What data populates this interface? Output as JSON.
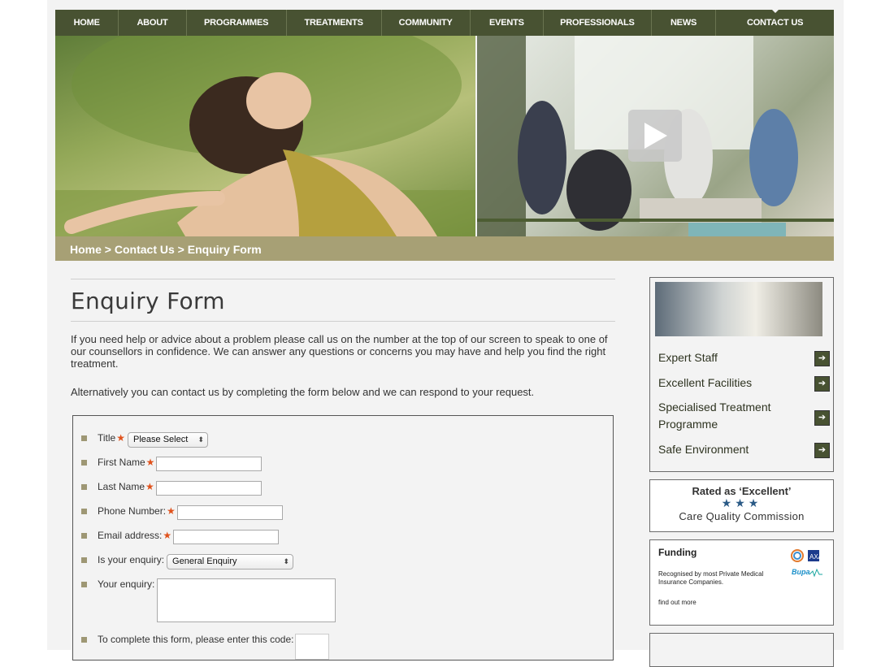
{
  "nav": {
    "items": [
      {
        "label": "HOME",
        "width": 78
      },
      {
        "label": "ABOUT",
        "width": 83
      },
      {
        "label": "PROGRAMMES",
        "width": 123
      },
      {
        "label": "TREATMENTS",
        "width": 117
      },
      {
        "label": "COMMUNITY",
        "width": 109
      },
      {
        "label": "EVENTS",
        "width": 90
      },
      {
        "label": "PROFESSIONALS",
        "width": 133
      },
      {
        "label": "NEWS",
        "width": 79
      },
      {
        "label": "CONTACT US",
        "width": 146
      }
    ]
  },
  "breadcrumb": {
    "home": "Home",
    "sep1": ">",
    "contact": "Contact Us",
    "sep2": ">",
    "current": "Enquiry Form"
  },
  "main": {
    "title": "Enquiry Form",
    "intro1": "If you need help or advice about a problem please call us on the number at the top of our screen to speak to one of our counsellors in confidence. We can answer any questions or concerns you may have and help you find the right treatment.",
    "intro2": "Alternatively you can contact us by completing the form below and we can respond to your request."
  },
  "form": {
    "title_label": "Title",
    "title_value": "Please Select",
    "first_name_label": "First Name",
    "last_name_label": "Last Name",
    "phone_label": "Phone Number:",
    "email_label": "Email address:",
    "enquiry_type_label": "Is your enquiry:",
    "enquiry_type_value": "General Enquiry",
    "enquiry_label": "Your enquiry:",
    "captcha_label": "To complete this form, please enter this code:",
    "required_mark": "★"
  },
  "sidebar": {
    "links": [
      {
        "label": "Expert Staff"
      },
      {
        "label": "Excellent Facilities"
      },
      {
        "label": "Specialised Treatment Programme"
      },
      {
        "label": "Safe Environment"
      }
    ],
    "arrow": "➔",
    "rating": {
      "rated": "Rated as ‘Excellent’",
      "stars": "★★★",
      "org": "Care Quality Commission"
    },
    "funding": {
      "title": "Funding",
      "desc": "Recognised by most Private Medical Insurance Companies.",
      "more": "find out more",
      "bupa": "Bupa"
    }
  },
  "colors": {
    "nav_bg": "#485232",
    "crumb_bg": "#a7a075",
    "required": "#e0521c",
    "star": "#2a5a86"
  }
}
